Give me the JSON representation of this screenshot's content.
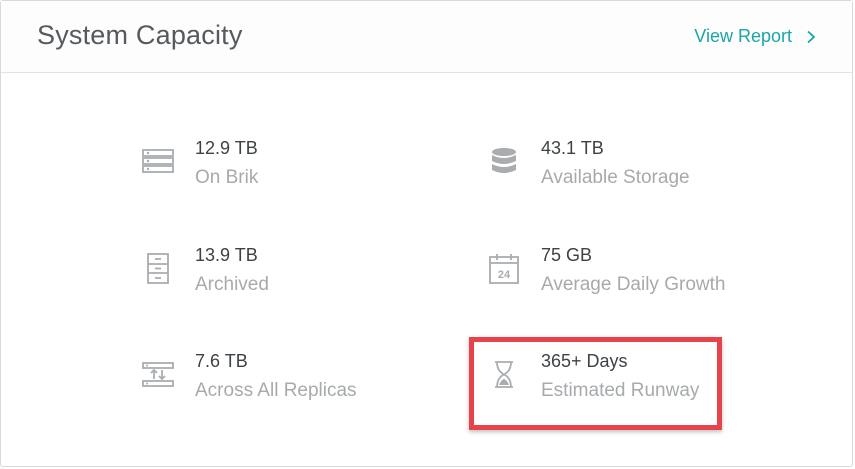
{
  "header": {
    "title": "System Capacity",
    "view_report_label": "View Report"
  },
  "stats": [
    {
      "value": "12.9 TB",
      "label": "On Brik",
      "icon": "server-rack-icon"
    },
    {
      "value": "43.1 TB",
      "label": "Available Storage",
      "icon": "database-icon"
    },
    {
      "value": "13.9 TB",
      "label": "Archived",
      "icon": "file-cabinet-icon"
    },
    {
      "value": "75 GB",
      "label": "Average Daily Growth",
      "icon": "calendar-24-icon"
    },
    {
      "value": "7.6 TB",
      "label": "Across All Replicas",
      "icon": "replication-icon"
    },
    {
      "value": "365+ Days",
      "label": "Estimated Runway",
      "icon": "hourglass-icon"
    }
  ],
  "colors": {
    "accent": "#1aa5a8",
    "highlight": "#e8434a",
    "icon": "#a9adb0"
  }
}
